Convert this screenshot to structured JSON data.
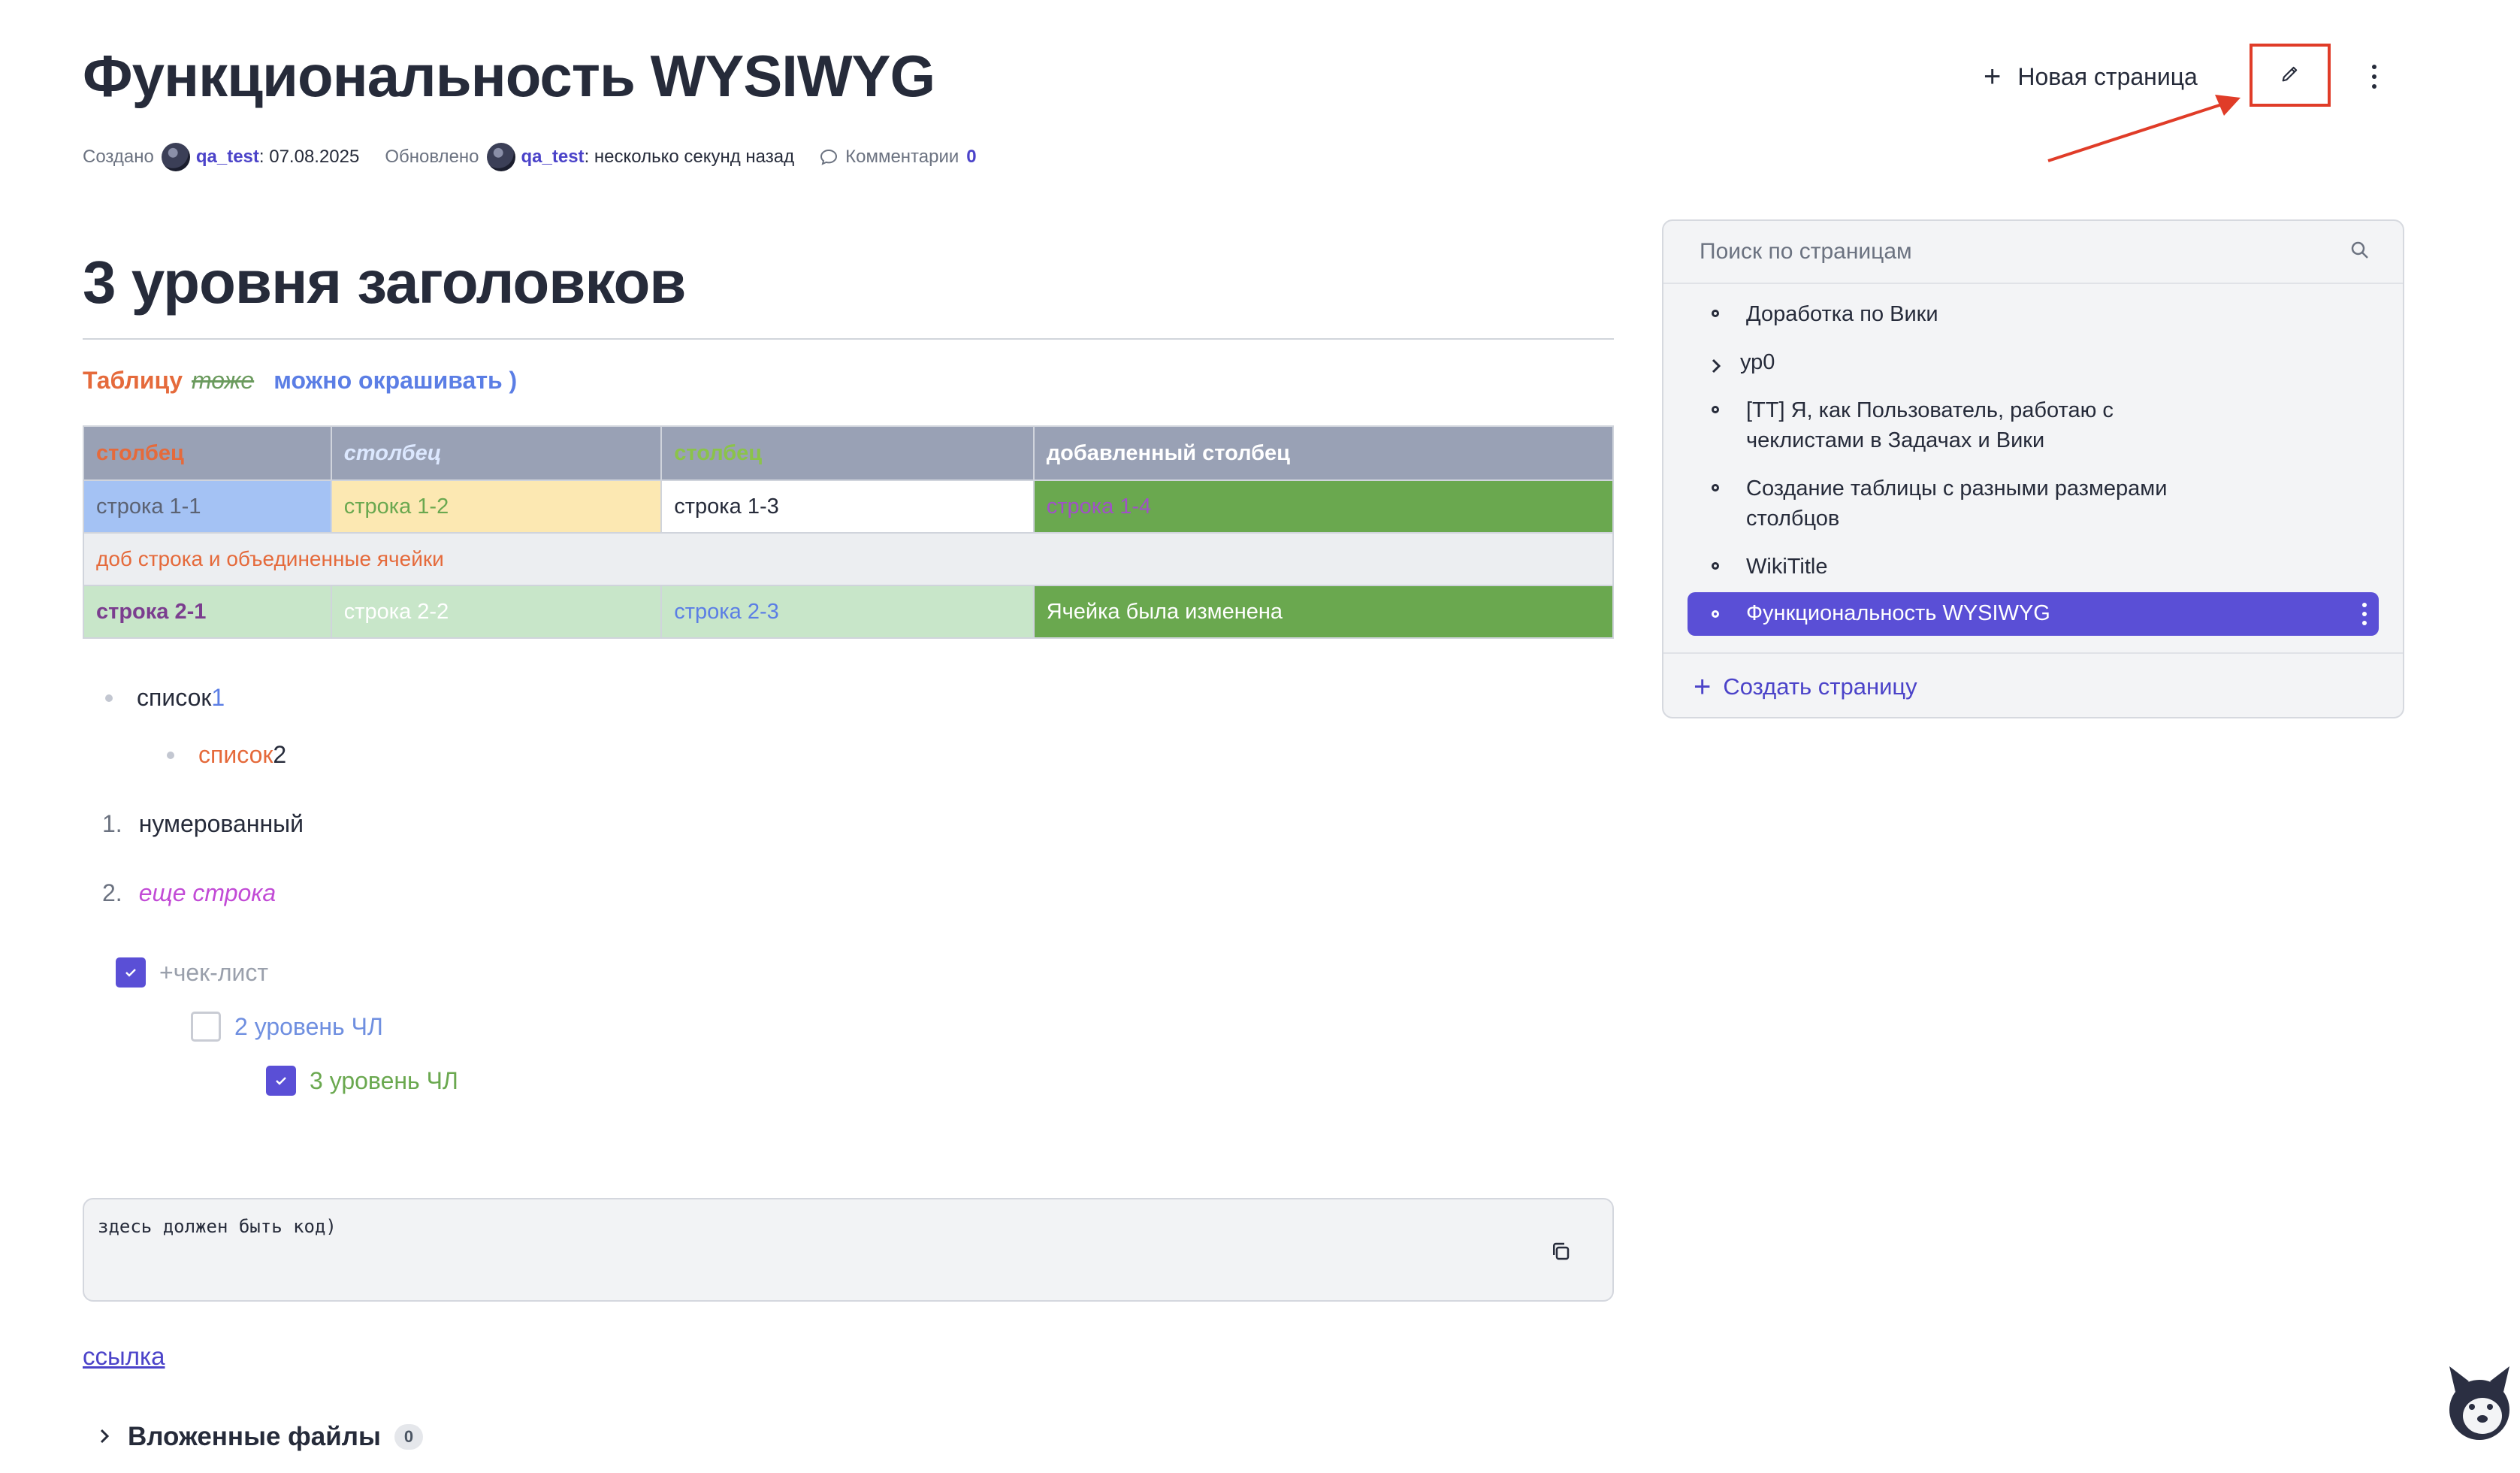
{
  "page": {
    "title": "Функциональность WYSIWYG",
    "meta": {
      "created_label": "Создано",
      "created_user": "qa_test",
      "created_value": ": 07.08.2025",
      "updated_label": "Обновлено",
      "updated_user": "qa_test",
      "updated_value": ": несколько секунд назад",
      "comments_label": "Комментарии",
      "comments_count": "0"
    }
  },
  "toolbar": {
    "new_page_label": "Новая страница",
    "edit_icon": "pencil-icon",
    "more_icon": "kebab-icon"
  },
  "content": {
    "heading": "3 уровня заголовков",
    "table_caption": {
      "part1": "Таблицу",
      "part2": "тоже",
      "part3": "можно окрашивать )"
    },
    "table": {
      "headers": [
        "столбец",
        "столбец",
        "столбец",
        "добавленный столбец"
      ],
      "row1": [
        "строка 1-1",
        "строка 1-2",
        "строка 1-3",
        "строка 1-4"
      ],
      "merged": "доб строка и объединенные ячейки",
      "row2": [
        "строка 2-1",
        "строка 2-2",
        "строка 2-3",
        "Ячейка была изменена"
      ]
    },
    "bullets": [
      {
        "text": "список ",
        "suffix": "1"
      },
      {
        "text": "список",
        "suffix": " 2"
      }
    ],
    "ordered": [
      {
        "num": "1.",
        "text": "нумерованный"
      },
      {
        "num": "2.",
        "text": "еще строка"
      }
    ],
    "checklist": [
      {
        "text": "+чек-лист",
        "checked": true
      },
      {
        "text": "2 уровень ЧЛ",
        "checked": false
      },
      {
        "text": "3 уровень ЧЛ",
        "checked": true
      }
    ],
    "code": "здесь должен быть код)",
    "link": "ссылка",
    "attachments": {
      "label": "Вложенные файлы",
      "count": "0"
    }
  },
  "sidebar": {
    "search_placeholder": "Поиск по страницам",
    "items": [
      {
        "line1": "Доработка по Вики",
        "line2": ""
      },
      {
        "line1": "ур0",
        "line2": ""
      },
      {
        "line1": "[ТТ] Я, как Пользователь, работаю с",
        "line2": "чеклистами в Задачах и Вики"
      },
      {
        "line1": "Создание таблицы с разными размерами",
        "line2": "столбцов"
      },
      {
        "line1": "WikiTitle",
        "line2": ""
      },
      {
        "line1": "Функциональность WYSIWYG",
        "line2": ""
      }
    ],
    "create_label": "Создать страницу"
  },
  "colors": {
    "accent": "#5a4fd6",
    "highlight_box": "#e03c28",
    "table_header": "#99a1b5",
    "cell_blue": "#a4c2f4",
    "cell_yellow": "#fce8b2",
    "cell_green_dark": "#6aa84f",
    "cell_green_light": "#c8e6c9",
    "merged_row": "#eceef1"
  }
}
